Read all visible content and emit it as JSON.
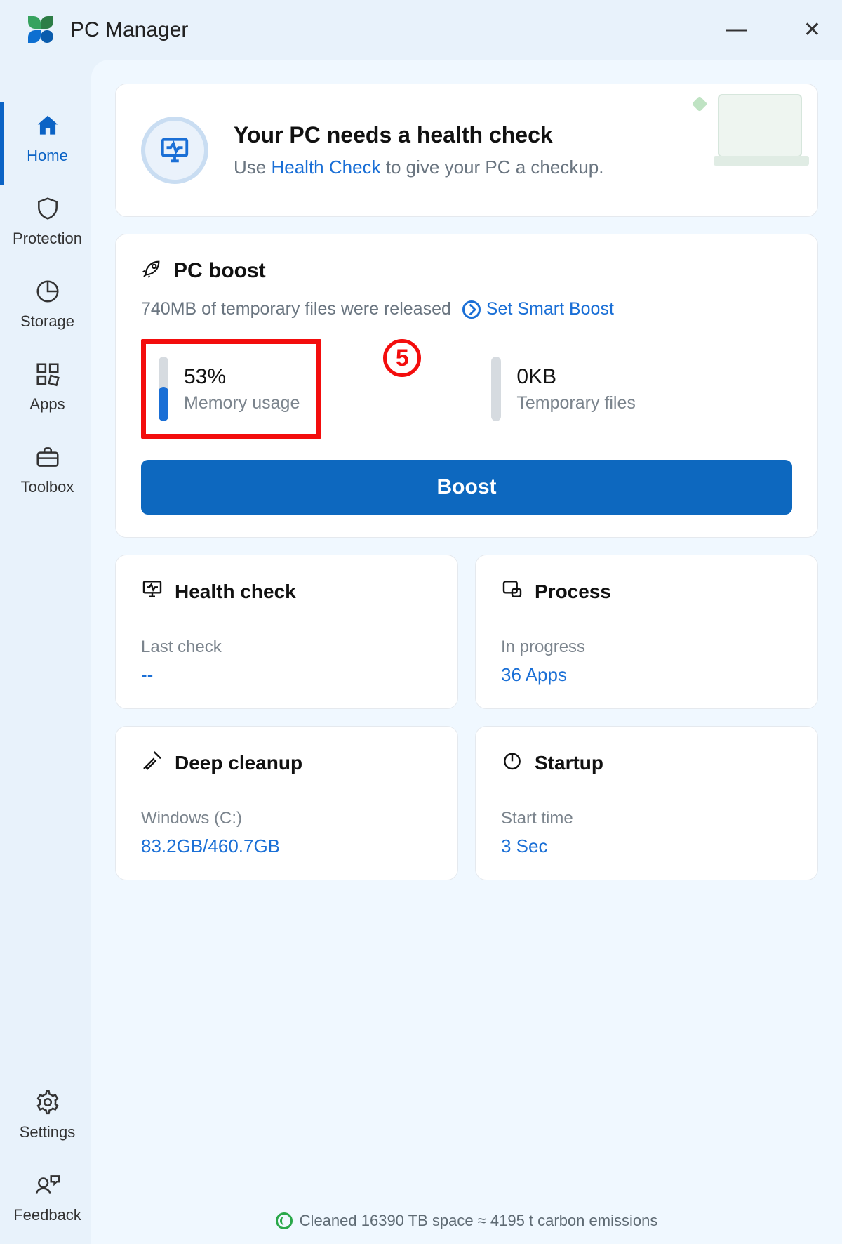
{
  "app": {
    "title": "PC Manager"
  },
  "sidebar": {
    "items": [
      {
        "label": "Home"
      },
      {
        "label": "Protection"
      },
      {
        "label": "Storage"
      },
      {
        "label": "Apps"
      },
      {
        "label": "Toolbox"
      }
    ],
    "bottom": [
      {
        "label": "Settings"
      },
      {
        "label": "Feedback"
      }
    ]
  },
  "hero": {
    "title": "Your PC needs a health check",
    "prefix": "Use ",
    "link": "Health Check",
    "suffix": " to give your PC a checkup."
  },
  "boost": {
    "title": "PC boost",
    "released": "740MB of temporary files were released",
    "smart_link": "Set Smart Boost",
    "memory": {
      "value": "53%",
      "label": "Memory usage",
      "percent": 53
    },
    "temp": {
      "value": "0KB",
      "label": "Temporary files",
      "percent": 0
    },
    "button": "Boost",
    "annotation": "5"
  },
  "tiles": {
    "health": {
      "title": "Health check",
      "k": "Last check",
      "v": "--"
    },
    "process": {
      "title": "Process",
      "k": "In progress",
      "v": "36 Apps"
    },
    "cleanup": {
      "title": "Deep cleanup",
      "k": "Windows (C:)",
      "v": "83.2GB/460.7GB"
    },
    "startup": {
      "title": "Startup",
      "k": "Start time",
      "v": "3 Sec"
    }
  },
  "footer": "Cleaned 16390 TB space ≈ 4195 t carbon emissions"
}
